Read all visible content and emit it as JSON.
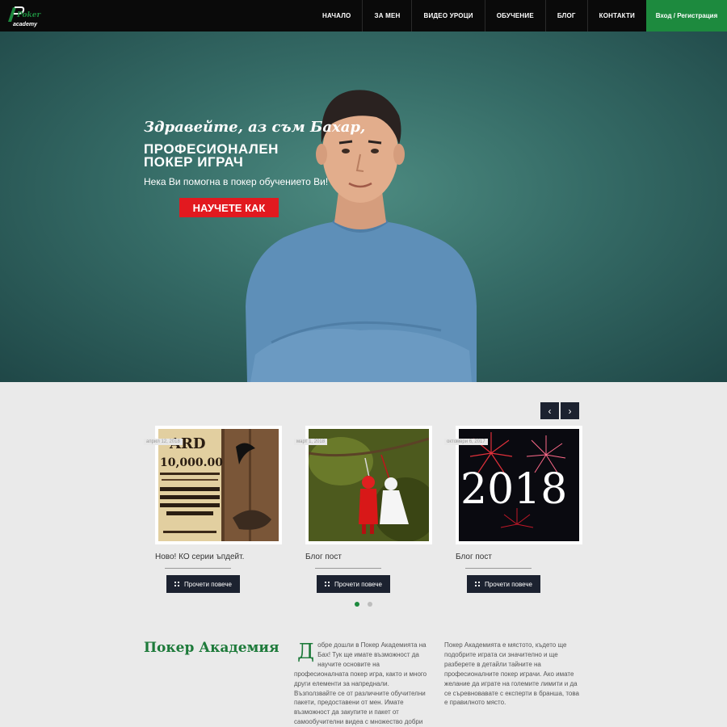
{
  "nav": {
    "items": [
      {
        "label": "НАЧАЛО"
      },
      {
        "label": "ЗА МЕН"
      },
      {
        "label": "ВИДЕО УРОЦИ"
      },
      {
        "label": "ОБУЧЕНИЕ"
      },
      {
        "label": "БЛОГ"
      },
      {
        "label": "КОНТАКТИ"
      }
    ],
    "login_label": "Вход / Регистрация",
    "logo_text_top": "Poker",
    "logo_text_bottom": "academy"
  },
  "hero": {
    "greeting": "Здравейте, аз съм Бахар,",
    "title_line1": "ПРОФЕСИОНАЛЕН",
    "title_line2": "ПОКЕР ИГРАЧ",
    "subtitle": "Нека Ви помогна в покер обучението Ви!",
    "cta_label": "НАУЧЕТЕ КАК"
  },
  "slider": {
    "prev_icon": "chevron-left-icon",
    "next_icon": "chevron-right-icon",
    "prev_glyph": "‹",
    "next_glyph": "›",
    "active_dot": 0
  },
  "posts": [
    {
      "date": "април 12, 2018",
      "title": "Ново! КО серии ъпдейт.",
      "read_more": "Прочети повече",
      "image": "wanted-poster"
    },
    {
      "date": "март 1, 2018",
      "title": "Блог пост",
      "read_more": "Прочети повече",
      "image": "martenitsa"
    },
    {
      "date": "октомври 6, 2017",
      "title": "Блог пост",
      "read_more": "Прочети повече",
      "image": "fireworks-2018"
    }
  ],
  "about": {
    "title": "Покер Академия",
    "dropcap": "Д",
    "col1_text": "обре дошли в Покер Академията на Бах! Тук ще имате възможност да научите основите на професионалната покер игра, както и много други елементи за напреднали. Възползвайте се от различните обучителни пакети, предоставени от мен. Имате възможност да закупите и пакет от самообучителни видеа с множество добри",
    "col2_text": "Покер Академията е мястото, където ще подобрите играта си значително и ще разберете в детайли тайните на професионалните покер играчи. Ако имате желание да играте на големите лимити и да се съревновавате с експерти в бранша, това е правилното място."
  },
  "colors": {
    "nav_bg": "#0a0a0a",
    "accent_green": "#1d8a3e",
    "cta_red": "#e2191f",
    "dark_button": "#1c2230",
    "hero_teal": "#356b66"
  }
}
